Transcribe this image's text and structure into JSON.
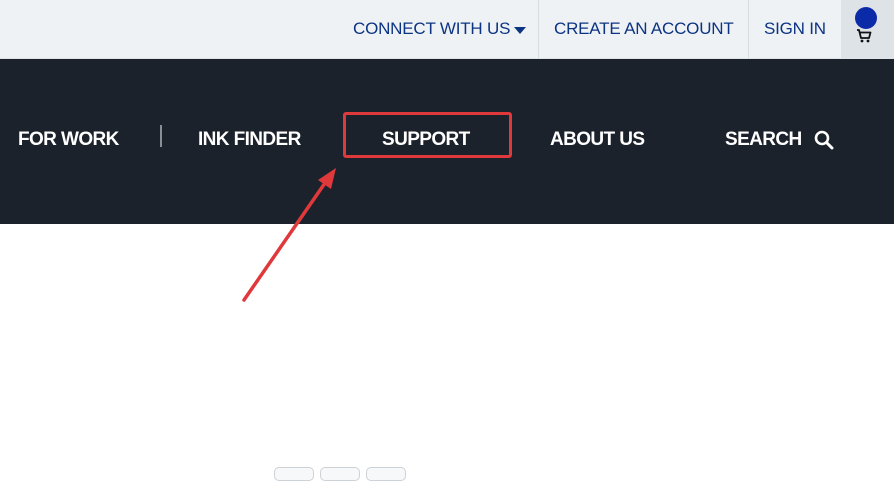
{
  "topbar": {
    "connect_label": "CONNECT WITH US",
    "create_account_label": "CREATE AN ACCOUNT",
    "sign_in_label": "SIGN IN",
    "cart_icon": "shopping-cart-icon"
  },
  "nav": {
    "for_work": "FOR WORK",
    "ink_finder": "INK FINDER",
    "support": "SUPPORT",
    "about_us": "ABOUT US",
    "search": "SEARCH",
    "search_icon": "magnifier-icon"
  },
  "colors": {
    "topbar_bg": "#eef2f4",
    "link_blue": "#0c3483",
    "nav_bg": "#1c222b",
    "annotation_red": "#e0393c",
    "badge_blue": "#0b2aa8"
  }
}
